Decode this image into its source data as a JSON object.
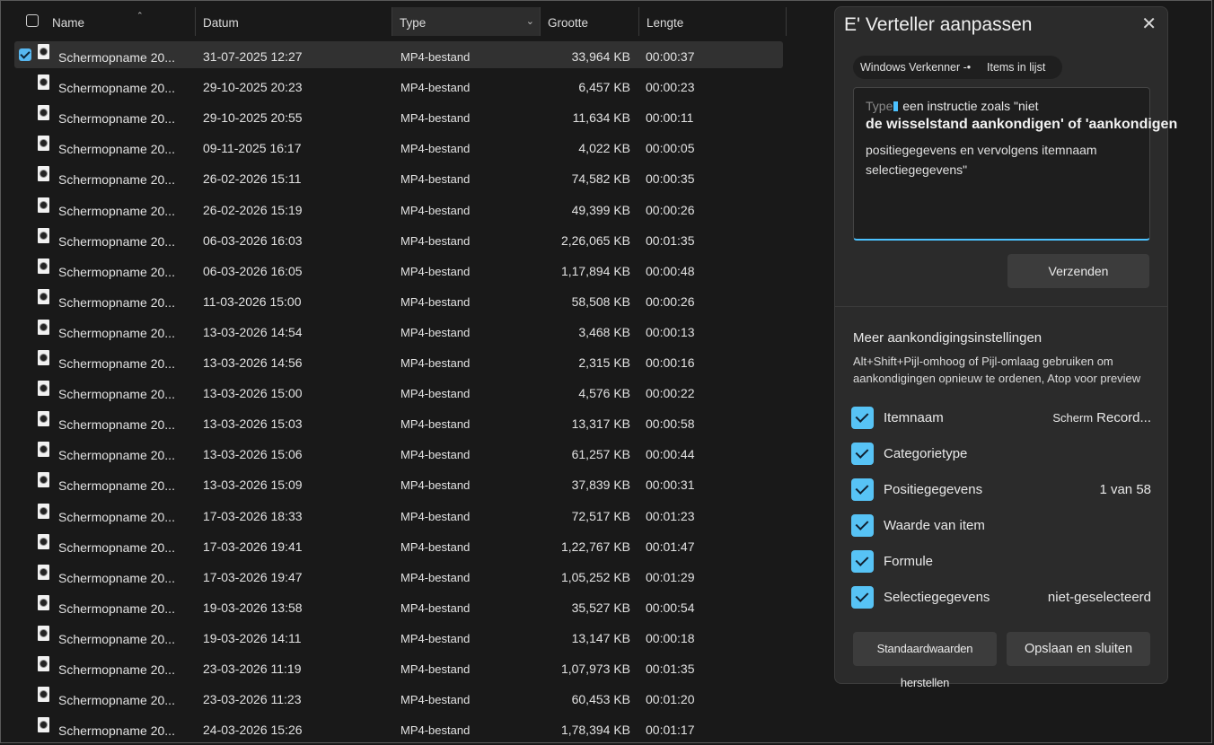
{
  "columns": {
    "name": "Name",
    "date": "Datum",
    "type": "Type",
    "size": "Grootte",
    "length": "Lengte"
  },
  "files": [
    {
      "name": "Schermopname 20...",
      "date": "31-07-2025 12:27",
      "type": "MP4-bestand",
      "size": "33,964 KB",
      "length": "00:00:37",
      "selected": true
    },
    {
      "name": "Schermopname 20...",
      "date": "29-10-2025 20:23",
      "type": "MP4-bestand",
      "size": "6,457 KB",
      "length": "00:00:23"
    },
    {
      "name": "Schermopname 20...",
      "date": "29-10-2025 20:55",
      "type": "MP4-bestand",
      "size": "11,634 KB",
      "length": "00:00:11"
    },
    {
      "name": "Schermopname 20...",
      "date": "09-11-2025 16:17",
      "type": "MP4-bestand",
      "size": "4,022 KB",
      "length": "00:00:05"
    },
    {
      "name": "Schermopname 20...",
      "date": "26-02-2026 15:11",
      "type": "MP4-bestand",
      "size": "74,582 KB",
      "length": "00:00:35"
    },
    {
      "name": "Schermopname 20...",
      "date": "26-02-2026 15:19",
      "type": "MP4-bestand",
      "size": "49,399 KB",
      "length": "00:00:26"
    },
    {
      "name": "Schermopname 20...",
      "date": "06-03-2026 16:03",
      "type": "MP4-bestand",
      "size": "2,26,065 KB",
      "length": "00:01:35"
    },
    {
      "name": "Schermopname 20...",
      "date": "06-03-2026 16:05",
      "type": "MP4-bestand",
      "size": "1,17,894 KB",
      "length": "00:00:48"
    },
    {
      "name": "Schermopname 20...",
      "date": "11-03-2026 15:00",
      "type": "MP4-bestand",
      "size": "58,508 KB",
      "length": "00:00:26"
    },
    {
      "name": "Schermopname 20...",
      "date": "13-03-2026 14:54",
      "type": "MP4-bestand",
      "size": "3,468 KB",
      "length": "00:00:13"
    },
    {
      "name": "Schermopname 20...",
      "date": "13-03-2026 14:56",
      "type": "MP4-bestand",
      "size": "2,315 KB",
      "length": "00:00:16"
    },
    {
      "name": "Schermopname 20...",
      "date": "13-03-2026 15:00",
      "type": "MP4-bestand",
      "size": "4,576 KB",
      "length": "00:00:22"
    },
    {
      "name": "Schermopname 20...",
      "date": "13-03-2026 15:03",
      "type": "MP4-bestand",
      "size": "13,317 KB",
      "length": "00:00:58"
    },
    {
      "name": "Schermopname 20...",
      "date": "13-03-2026 15:06",
      "type": "MP4-bestand",
      "size": "61,257 KB",
      "length": "00:00:44"
    },
    {
      "name": "Schermopname 20...",
      "date": "13-03-2026 15:09",
      "type": "MP4-bestand",
      "size": "37,839 KB",
      "length": "00:00:31"
    },
    {
      "name": "Schermopname 20...",
      "date": "17-03-2026 18:33",
      "type": "MP4-bestand",
      "size": "72,517 KB",
      "length": "00:01:23"
    },
    {
      "name": "Schermopname 20...",
      "date": "17-03-2026 19:41",
      "type": "MP4-bestand",
      "size": "1,22,767 KB",
      "length": "00:01:47"
    },
    {
      "name": "Schermopname 20...",
      "date": "17-03-2026 19:47",
      "type": "MP4-bestand",
      "size": "1,05,252 KB",
      "length": "00:01:29"
    },
    {
      "name": "Schermopname 20...",
      "date": "19-03-2026 13:58",
      "type": "MP4-bestand",
      "size": "35,527 KB",
      "length": "00:00:54"
    },
    {
      "name": "Schermopname 20...",
      "date": "19-03-2026 14:11",
      "type": "MP4-bestand",
      "size": "13,147 KB",
      "length": "00:00:18"
    },
    {
      "name": "Schermopname 20...",
      "date": "23-03-2026 11:19",
      "type": "MP4-bestand",
      "size": "1,07,973 KB",
      "length": "00:01:35"
    },
    {
      "name": "Schermopname 20...",
      "date": "23-03-2026 11:23",
      "type": "MP4-bestand",
      "size": "60,453 KB",
      "length": "00:01:20"
    },
    {
      "name": "Schermopname 20...",
      "date": "24-03-2026 15:26",
      "type": "MP4-bestand",
      "size": "1,78,394 KB",
      "length": "00:01:17"
    }
  ],
  "panel": {
    "title": "E' Verteller aanpassen",
    "chip_app": "Windows Verkenner -•",
    "chip_context": "Items in lijst",
    "placeholder_dim": "Type",
    "placeholder_line1": "een instructie zoals \"niet",
    "placeholder_line2": "de wisselstand aankondigen' of 'aankondigen",
    "placeholder_line3": "positiegegevens en vervolgens itemnaam selectiegegevens\"",
    "send_label": "Verzenden",
    "more_title": "Meer aankondigingsinstellingen",
    "more_desc": "Alt+Shift+Pijl-omhoog of Pijl-omlaag gebruiken om aankondigingen opnieuw te ordenen, Atop voor preview",
    "options": [
      {
        "label": "Itemnaam",
        "value_prefix": "Scherm",
        "value": "Record...",
        "checked": true
      },
      {
        "label": "Categorietype",
        "value_prefix": "",
        "value": "",
        "checked": true
      },
      {
        "label": "Positiegegevens",
        "value_prefix": "",
        "value": "1 van 58",
        "checked": true
      },
      {
        "label": "Waarde van item",
        "value_prefix": "",
        "value": "",
        "checked": true
      },
      {
        "label": "Formule",
        "value_prefix": "",
        "value": "",
        "checked": true
      },
      {
        "label": "Selectiegegevens",
        "value_prefix": "",
        "value": "niet-geselecteerd",
        "checked": true
      }
    ],
    "reset_label": "Standaardwaarden herstellen",
    "save_label": "Opslaan en sluiten"
  },
  "colors": {
    "accent": "#4cc2ff",
    "checkbox": "#57c3f5",
    "background": "#191919",
    "panel": "#2b2b2b"
  }
}
